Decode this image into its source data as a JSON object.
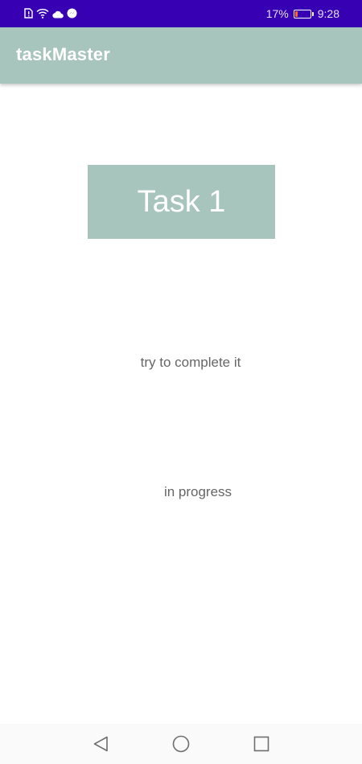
{
  "status_bar": {
    "battery_percent": "17%",
    "battery_level": 0.17,
    "time": "9:28",
    "icons": [
      "sim-alert-icon",
      "wifi-icon",
      "cloud-icon",
      "messenger-icon",
      "battery-icon"
    ]
  },
  "app_bar": {
    "title": "taskMaster",
    "color": "#a8c5bd"
  },
  "task": {
    "title": "Task 1",
    "description": "try to complete it",
    "state": "in progress"
  },
  "nav_bar": {
    "icons": [
      "back-icon",
      "home-icon",
      "recents-icon"
    ]
  }
}
